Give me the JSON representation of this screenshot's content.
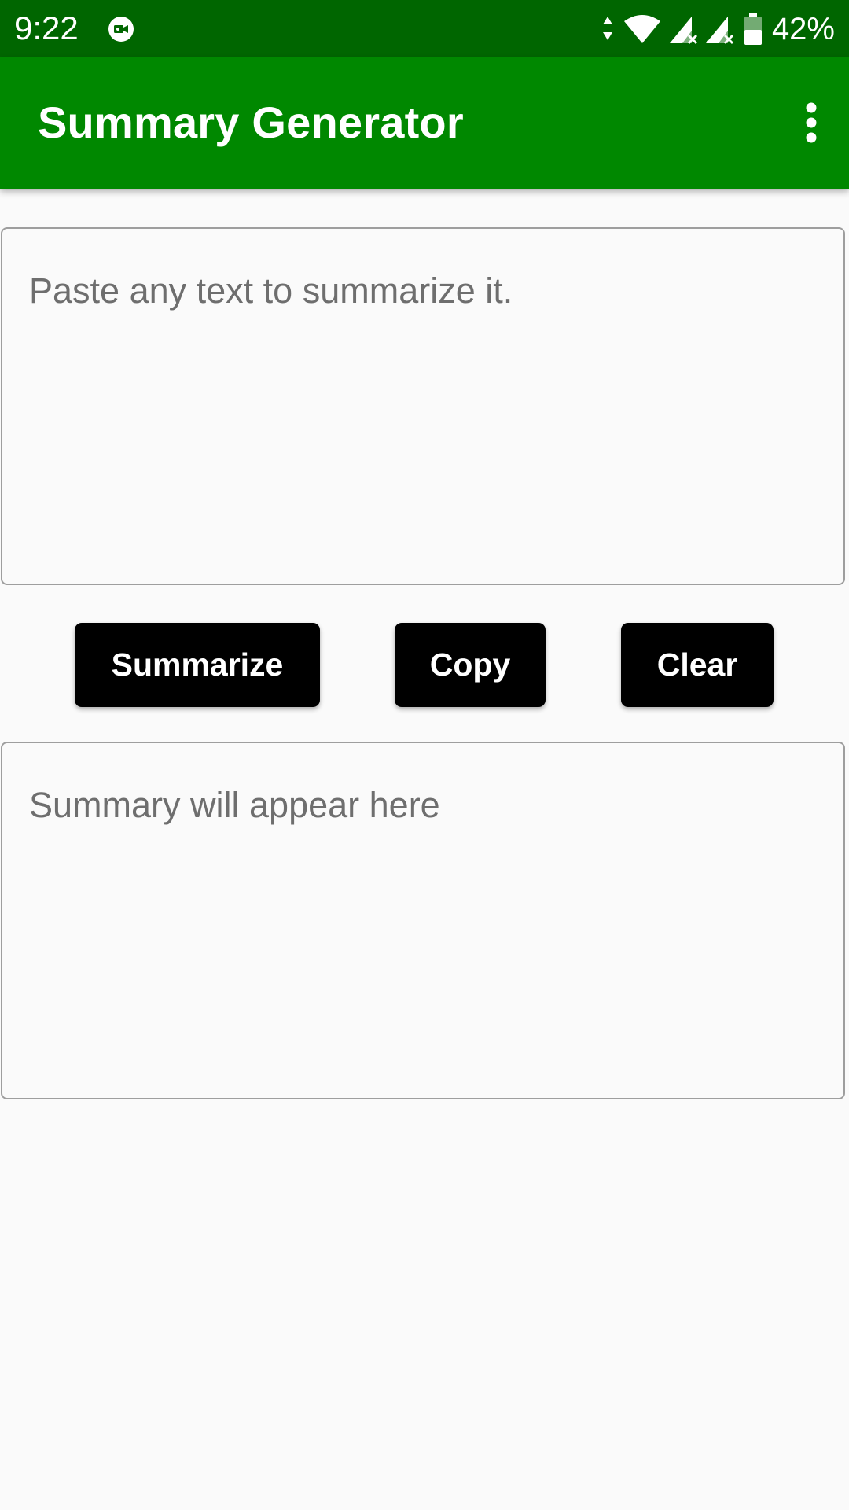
{
  "status_bar": {
    "time": "9:22",
    "battery_percent": "42%",
    "icons": [
      "video-call-notification-icon",
      "data-arrows-icon",
      "wifi-icon",
      "signal-no-sim-icon",
      "signal-no-sim-icon",
      "battery-icon"
    ]
  },
  "app_bar": {
    "title": "Summary Generator",
    "menu_icon": "overflow-menu-icon"
  },
  "input_box": {
    "placeholder": "Paste any text to summarize it."
  },
  "buttons": {
    "summarize": "Summarize",
    "copy": "Copy",
    "clear": "Clear"
  },
  "output_box": {
    "placeholder": "Summary will appear here"
  },
  "colors": {
    "status_bar": "#006600",
    "app_bar": "#008800",
    "button": "#000000",
    "background": "#fafafa"
  }
}
